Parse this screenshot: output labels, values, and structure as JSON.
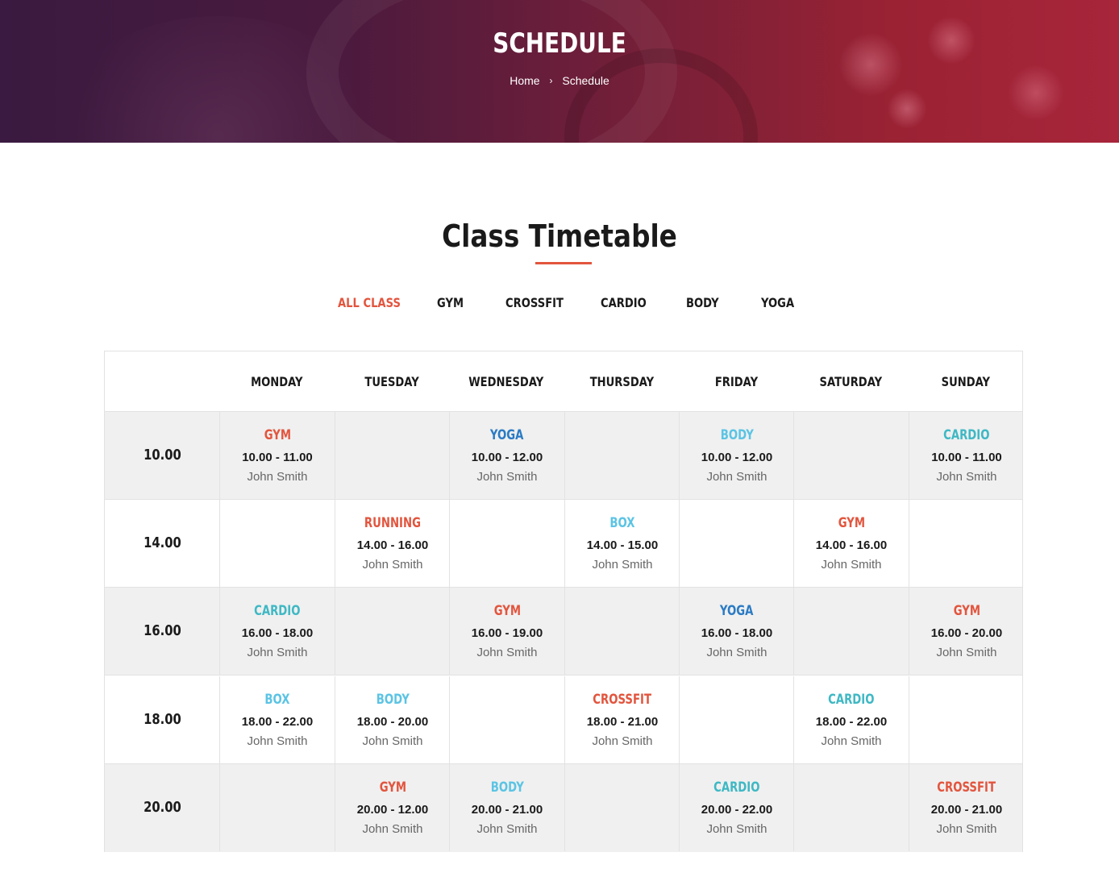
{
  "hero": {
    "title": "SCHEDULE",
    "breadcrumb": {
      "home": "Home",
      "separator": "›",
      "current": "Schedule"
    }
  },
  "section": {
    "title": "Class Timetable"
  },
  "filters": [
    "ALL CLASS",
    "GYM",
    "CROSSFIT",
    "CARDIO",
    "BODY",
    "YOGA"
  ],
  "active_filter": "ALL CLASS",
  "colors": {
    "accent": "#e2553e",
    "gym": "#e2553e",
    "running": "#e2553e",
    "crossfit": "#e2553e",
    "yoga": "#2b7bc4",
    "body": "#5bc4e4",
    "box": "#5bc4e4",
    "cardio": "#3fb8c4"
  },
  "timetable": {
    "days": [
      "MONDAY",
      "TUESDAY",
      "WEDNESDAY",
      "THURSDAY",
      "FRIDAY",
      "SATURDAY",
      "SUNDAY"
    ],
    "rows": [
      {
        "time": "10.00",
        "cells": [
          {
            "name": "GYM",
            "time": "10.00 - 11.00",
            "trainer": "John Smith",
            "color": "gym"
          },
          null,
          {
            "name": "YOGA",
            "time": "10.00 - 12.00",
            "trainer": "John Smith",
            "color": "yoga"
          },
          null,
          {
            "name": "BODY",
            "time": "10.00 - 12.00",
            "trainer": "John Smith",
            "color": "body"
          },
          null,
          {
            "name": "CARDIO",
            "time": "10.00 - 11.00",
            "trainer": "John Smith",
            "color": "cardio"
          }
        ]
      },
      {
        "time": "14.00",
        "cells": [
          null,
          {
            "name": "RUNNING",
            "time": "14.00 - 16.00",
            "trainer": "John Smith",
            "color": "running"
          },
          null,
          {
            "name": "BOX",
            "time": "14.00 - 15.00",
            "trainer": "John Smith",
            "color": "box"
          },
          null,
          {
            "name": "GYM",
            "time": "14.00 - 16.00",
            "trainer": "John Smith",
            "color": "gym"
          },
          null
        ]
      },
      {
        "time": "16.00",
        "cells": [
          {
            "name": "CARDIO",
            "time": "16.00 - 18.00",
            "trainer": "John Smith",
            "color": "cardio"
          },
          null,
          {
            "name": "GYM",
            "time": "16.00 - 19.00",
            "trainer": "John Smith",
            "color": "gym"
          },
          null,
          {
            "name": "YOGA",
            "time": "16.00 - 18.00",
            "trainer": "John Smith",
            "color": "yoga"
          },
          null,
          {
            "name": "GYM",
            "time": "16.00 - 20.00",
            "trainer": "John Smith",
            "color": "gym"
          }
        ]
      },
      {
        "time": "18.00",
        "cells": [
          {
            "name": "BOX",
            "time": "18.00 - 22.00",
            "trainer": "John Smith",
            "color": "box"
          },
          {
            "name": "BODY",
            "time": "18.00 - 20.00",
            "trainer": "John Smith",
            "color": "body"
          },
          null,
          {
            "name": "CROSSFIT",
            "time": "18.00 - 21.00",
            "trainer": "John Smith",
            "color": "crossfit"
          },
          null,
          {
            "name": "CARDIO",
            "time": "18.00 - 22.00",
            "trainer": "John Smith",
            "color": "cardio"
          },
          null
        ]
      },
      {
        "time": "20.00",
        "cells": [
          null,
          {
            "name": "GYM",
            "time": "20.00 - 12.00",
            "trainer": "John Smith",
            "color": "gym"
          },
          {
            "name": "BODY",
            "time": "20.00 - 21.00",
            "trainer": "John Smith",
            "color": "body"
          },
          null,
          {
            "name": "CARDIO",
            "time": "20.00 - 22.00",
            "trainer": "John Smith",
            "color": "cardio"
          },
          null,
          {
            "name": "CROSSFIT",
            "time": "20.00 - 21.00",
            "trainer": "John Smith",
            "color": "crossfit"
          }
        ]
      }
    ]
  }
}
